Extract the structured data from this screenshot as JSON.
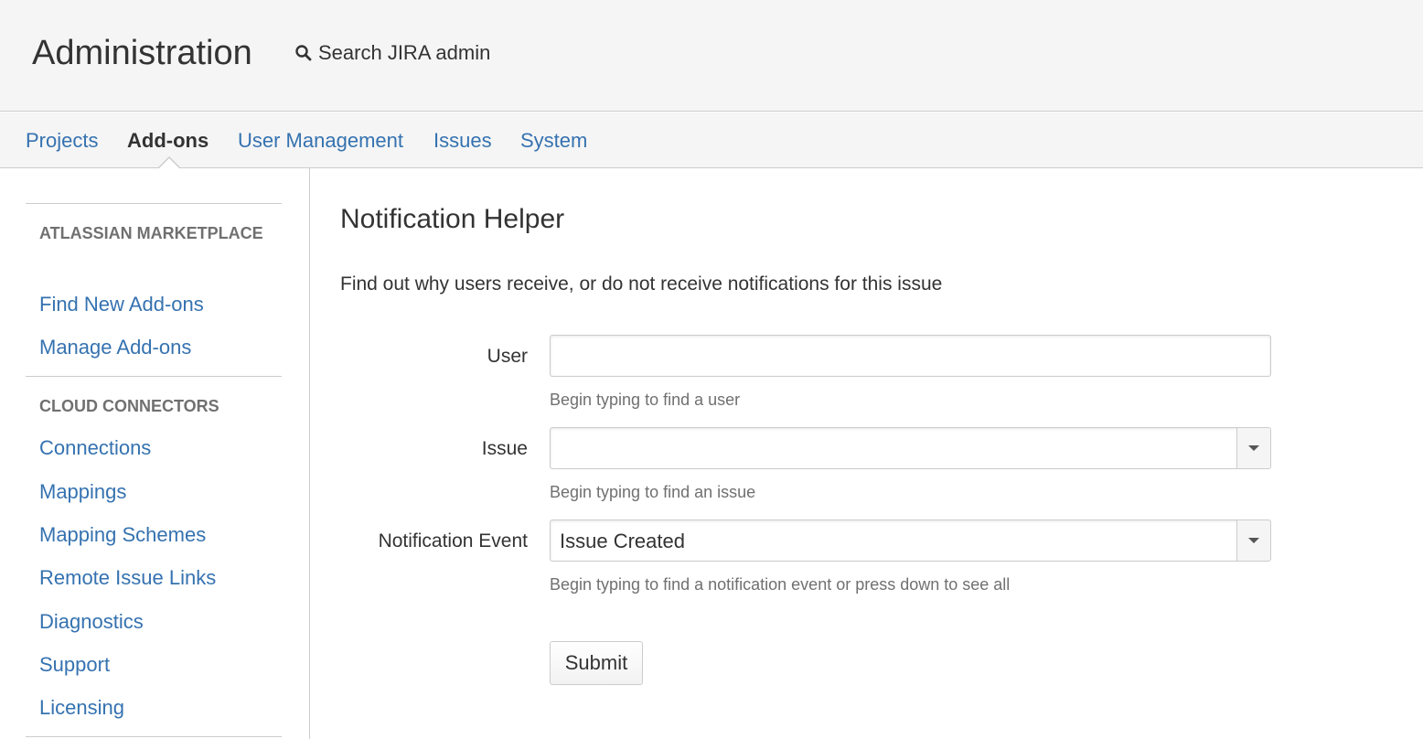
{
  "header": {
    "title": "Administration",
    "search_label": "Search JIRA admin",
    "search_icon": "search-icon"
  },
  "nav": {
    "tabs": [
      {
        "label": "Projects",
        "active": false
      },
      {
        "label": "Add-ons",
        "active": true
      },
      {
        "label": "User Management",
        "active": false
      },
      {
        "label": "Issues",
        "active": false
      },
      {
        "label": "System",
        "active": false
      }
    ]
  },
  "sidebar": {
    "sections": [
      {
        "heading": "ATLASSIAN MARKETPLACE",
        "items": [
          "Find New Add-ons",
          "Manage Add-ons"
        ]
      },
      {
        "heading": "CLOUD CONNECTORS",
        "items": [
          "Connections",
          "Mappings",
          "Mapping Schemes",
          "Remote Issue Links",
          "Diagnostics",
          "Support",
          "Licensing"
        ]
      }
    ]
  },
  "main": {
    "title": "Notification Helper",
    "description": "Find out why users receive, or do not receive notifications for this issue",
    "form": {
      "user": {
        "label": "User",
        "value": "",
        "description": "Begin typing to find a user"
      },
      "issue": {
        "label": "Issue",
        "value": "",
        "description": "Begin typing to find an issue"
      },
      "event": {
        "label": "Notification Event",
        "value": "Issue Created",
        "description": "Begin typing to find a notification event or press down to see all"
      },
      "submit_label": "Submit"
    }
  },
  "colors": {
    "link": "#3572b0",
    "header_bg": "#f5f5f5",
    "border": "#cccccc",
    "muted_text": "#707070"
  }
}
